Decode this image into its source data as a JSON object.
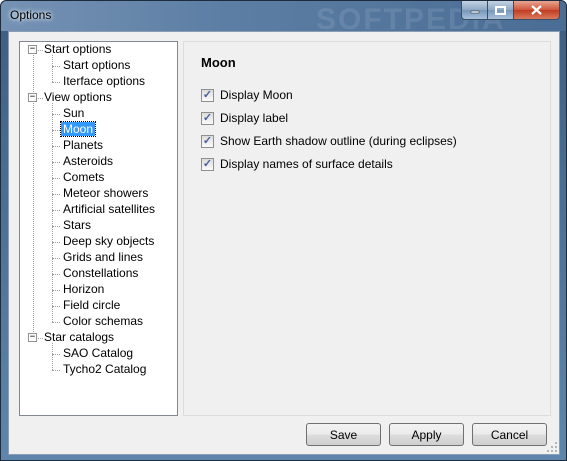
{
  "window": {
    "title": "Options",
    "watermark": "SOFTPEDIA"
  },
  "tree": {
    "groups": [
      {
        "label": "Start options",
        "expander": "−",
        "children": [
          "Start options",
          "Iterface options"
        ]
      },
      {
        "label": "View options",
        "expander": "−",
        "children": [
          "Sun",
          "Moon",
          "Planets",
          "Asteroids",
          "Comets",
          "Meteor showers",
          "Artificial satellites",
          "Stars",
          "Deep sky objects",
          "Grids and lines",
          "Constellations",
          "Horizon",
          "Field circle",
          "Color schemas"
        ]
      },
      {
        "label": "Star catalogs",
        "expander": "−",
        "children": [
          "SAO Catalog",
          "Tycho2 Catalog"
        ]
      }
    ],
    "selected": "Moon"
  },
  "panel": {
    "title": "Moon",
    "options": [
      {
        "label": "Display Moon",
        "checked": true
      },
      {
        "label": "Display label",
        "checked": true
      },
      {
        "label": "Show Earth shadow outline (during eclipses)",
        "checked": true
      },
      {
        "label": "Display names of surface details",
        "checked": true
      }
    ]
  },
  "buttons": {
    "save": "Save",
    "apply": "Apply",
    "cancel": "Cancel"
  },
  "colors": {
    "selection": "#3399ff",
    "checkmark": "#4a5f97",
    "close_button": "#c03c1f"
  }
}
